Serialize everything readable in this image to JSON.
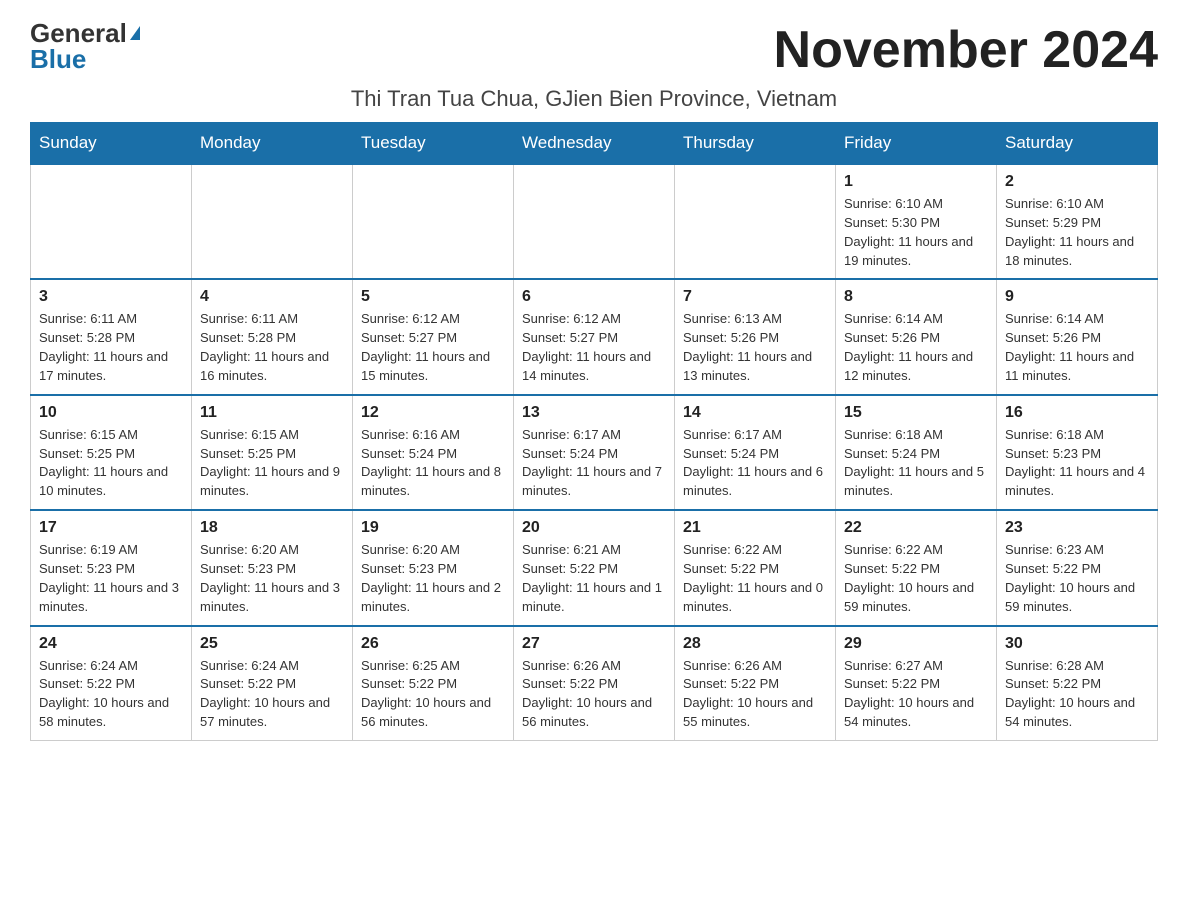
{
  "header": {
    "logo_general": "General",
    "logo_blue": "Blue",
    "month_year": "November 2024",
    "location": "Thi Tran Tua Chua, GJien Bien Province, Vietnam"
  },
  "weekdays": [
    "Sunday",
    "Monday",
    "Tuesday",
    "Wednesday",
    "Thursday",
    "Friday",
    "Saturday"
  ],
  "weeks": [
    [
      {
        "day": "",
        "info": ""
      },
      {
        "day": "",
        "info": ""
      },
      {
        "day": "",
        "info": ""
      },
      {
        "day": "",
        "info": ""
      },
      {
        "day": "",
        "info": ""
      },
      {
        "day": "1",
        "info": "Sunrise: 6:10 AM\nSunset: 5:30 PM\nDaylight: 11 hours and 19 minutes."
      },
      {
        "day": "2",
        "info": "Sunrise: 6:10 AM\nSunset: 5:29 PM\nDaylight: 11 hours and 18 minutes."
      }
    ],
    [
      {
        "day": "3",
        "info": "Sunrise: 6:11 AM\nSunset: 5:28 PM\nDaylight: 11 hours and 17 minutes."
      },
      {
        "day": "4",
        "info": "Sunrise: 6:11 AM\nSunset: 5:28 PM\nDaylight: 11 hours and 16 minutes."
      },
      {
        "day": "5",
        "info": "Sunrise: 6:12 AM\nSunset: 5:27 PM\nDaylight: 11 hours and 15 minutes."
      },
      {
        "day": "6",
        "info": "Sunrise: 6:12 AM\nSunset: 5:27 PM\nDaylight: 11 hours and 14 minutes."
      },
      {
        "day": "7",
        "info": "Sunrise: 6:13 AM\nSunset: 5:26 PM\nDaylight: 11 hours and 13 minutes."
      },
      {
        "day": "8",
        "info": "Sunrise: 6:14 AM\nSunset: 5:26 PM\nDaylight: 11 hours and 12 minutes."
      },
      {
        "day": "9",
        "info": "Sunrise: 6:14 AM\nSunset: 5:26 PM\nDaylight: 11 hours and 11 minutes."
      }
    ],
    [
      {
        "day": "10",
        "info": "Sunrise: 6:15 AM\nSunset: 5:25 PM\nDaylight: 11 hours and 10 minutes."
      },
      {
        "day": "11",
        "info": "Sunrise: 6:15 AM\nSunset: 5:25 PM\nDaylight: 11 hours and 9 minutes."
      },
      {
        "day": "12",
        "info": "Sunrise: 6:16 AM\nSunset: 5:24 PM\nDaylight: 11 hours and 8 minutes."
      },
      {
        "day": "13",
        "info": "Sunrise: 6:17 AM\nSunset: 5:24 PM\nDaylight: 11 hours and 7 minutes."
      },
      {
        "day": "14",
        "info": "Sunrise: 6:17 AM\nSunset: 5:24 PM\nDaylight: 11 hours and 6 minutes."
      },
      {
        "day": "15",
        "info": "Sunrise: 6:18 AM\nSunset: 5:24 PM\nDaylight: 11 hours and 5 minutes."
      },
      {
        "day": "16",
        "info": "Sunrise: 6:18 AM\nSunset: 5:23 PM\nDaylight: 11 hours and 4 minutes."
      }
    ],
    [
      {
        "day": "17",
        "info": "Sunrise: 6:19 AM\nSunset: 5:23 PM\nDaylight: 11 hours and 3 minutes."
      },
      {
        "day": "18",
        "info": "Sunrise: 6:20 AM\nSunset: 5:23 PM\nDaylight: 11 hours and 3 minutes."
      },
      {
        "day": "19",
        "info": "Sunrise: 6:20 AM\nSunset: 5:23 PM\nDaylight: 11 hours and 2 minutes."
      },
      {
        "day": "20",
        "info": "Sunrise: 6:21 AM\nSunset: 5:22 PM\nDaylight: 11 hours and 1 minute."
      },
      {
        "day": "21",
        "info": "Sunrise: 6:22 AM\nSunset: 5:22 PM\nDaylight: 11 hours and 0 minutes."
      },
      {
        "day": "22",
        "info": "Sunrise: 6:22 AM\nSunset: 5:22 PM\nDaylight: 10 hours and 59 minutes."
      },
      {
        "day": "23",
        "info": "Sunrise: 6:23 AM\nSunset: 5:22 PM\nDaylight: 10 hours and 59 minutes."
      }
    ],
    [
      {
        "day": "24",
        "info": "Sunrise: 6:24 AM\nSunset: 5:22 PM\nDaylight: 10 hours and 58 minutes."
      },
      {
        "day": "25",
        "info": "Sunrise: 6:24 AM\nSunset: 5:22 PM\nDaylight: 10 hours and 57 minutes."
      },
      {
        "day": "26",
        "info": "Sunrise: 6:25 AM\nSunset: 5:22 PM\nDaylight: 10 hours and 56 minutes."
      },
      {
        "day": "27",
        "info": "Sunrise: 6:26 AM\nSunset: 5:22 PM\nDaylight: 10 hours and 56 minutes."
      },
      {
        "day": "28",
        "info": "Sunrise: 6:26 AM\nSunset: 5:22 PM\nDaylight: 10 hours and 55 minutes."
      },
      {
        "day": "29",
        "info": "Sunrise: 6:27 AM\nSunset: 5:22 PM\nDaylight: 10 hours and 54 minutes."
      },
      {
        "day": "30",
        "info": "Sunrise: 6:28 AM\nSunset: 5:22 PM\nDaylight: 10 hours and 54 minutes."
      }
    ]
  ]
}
